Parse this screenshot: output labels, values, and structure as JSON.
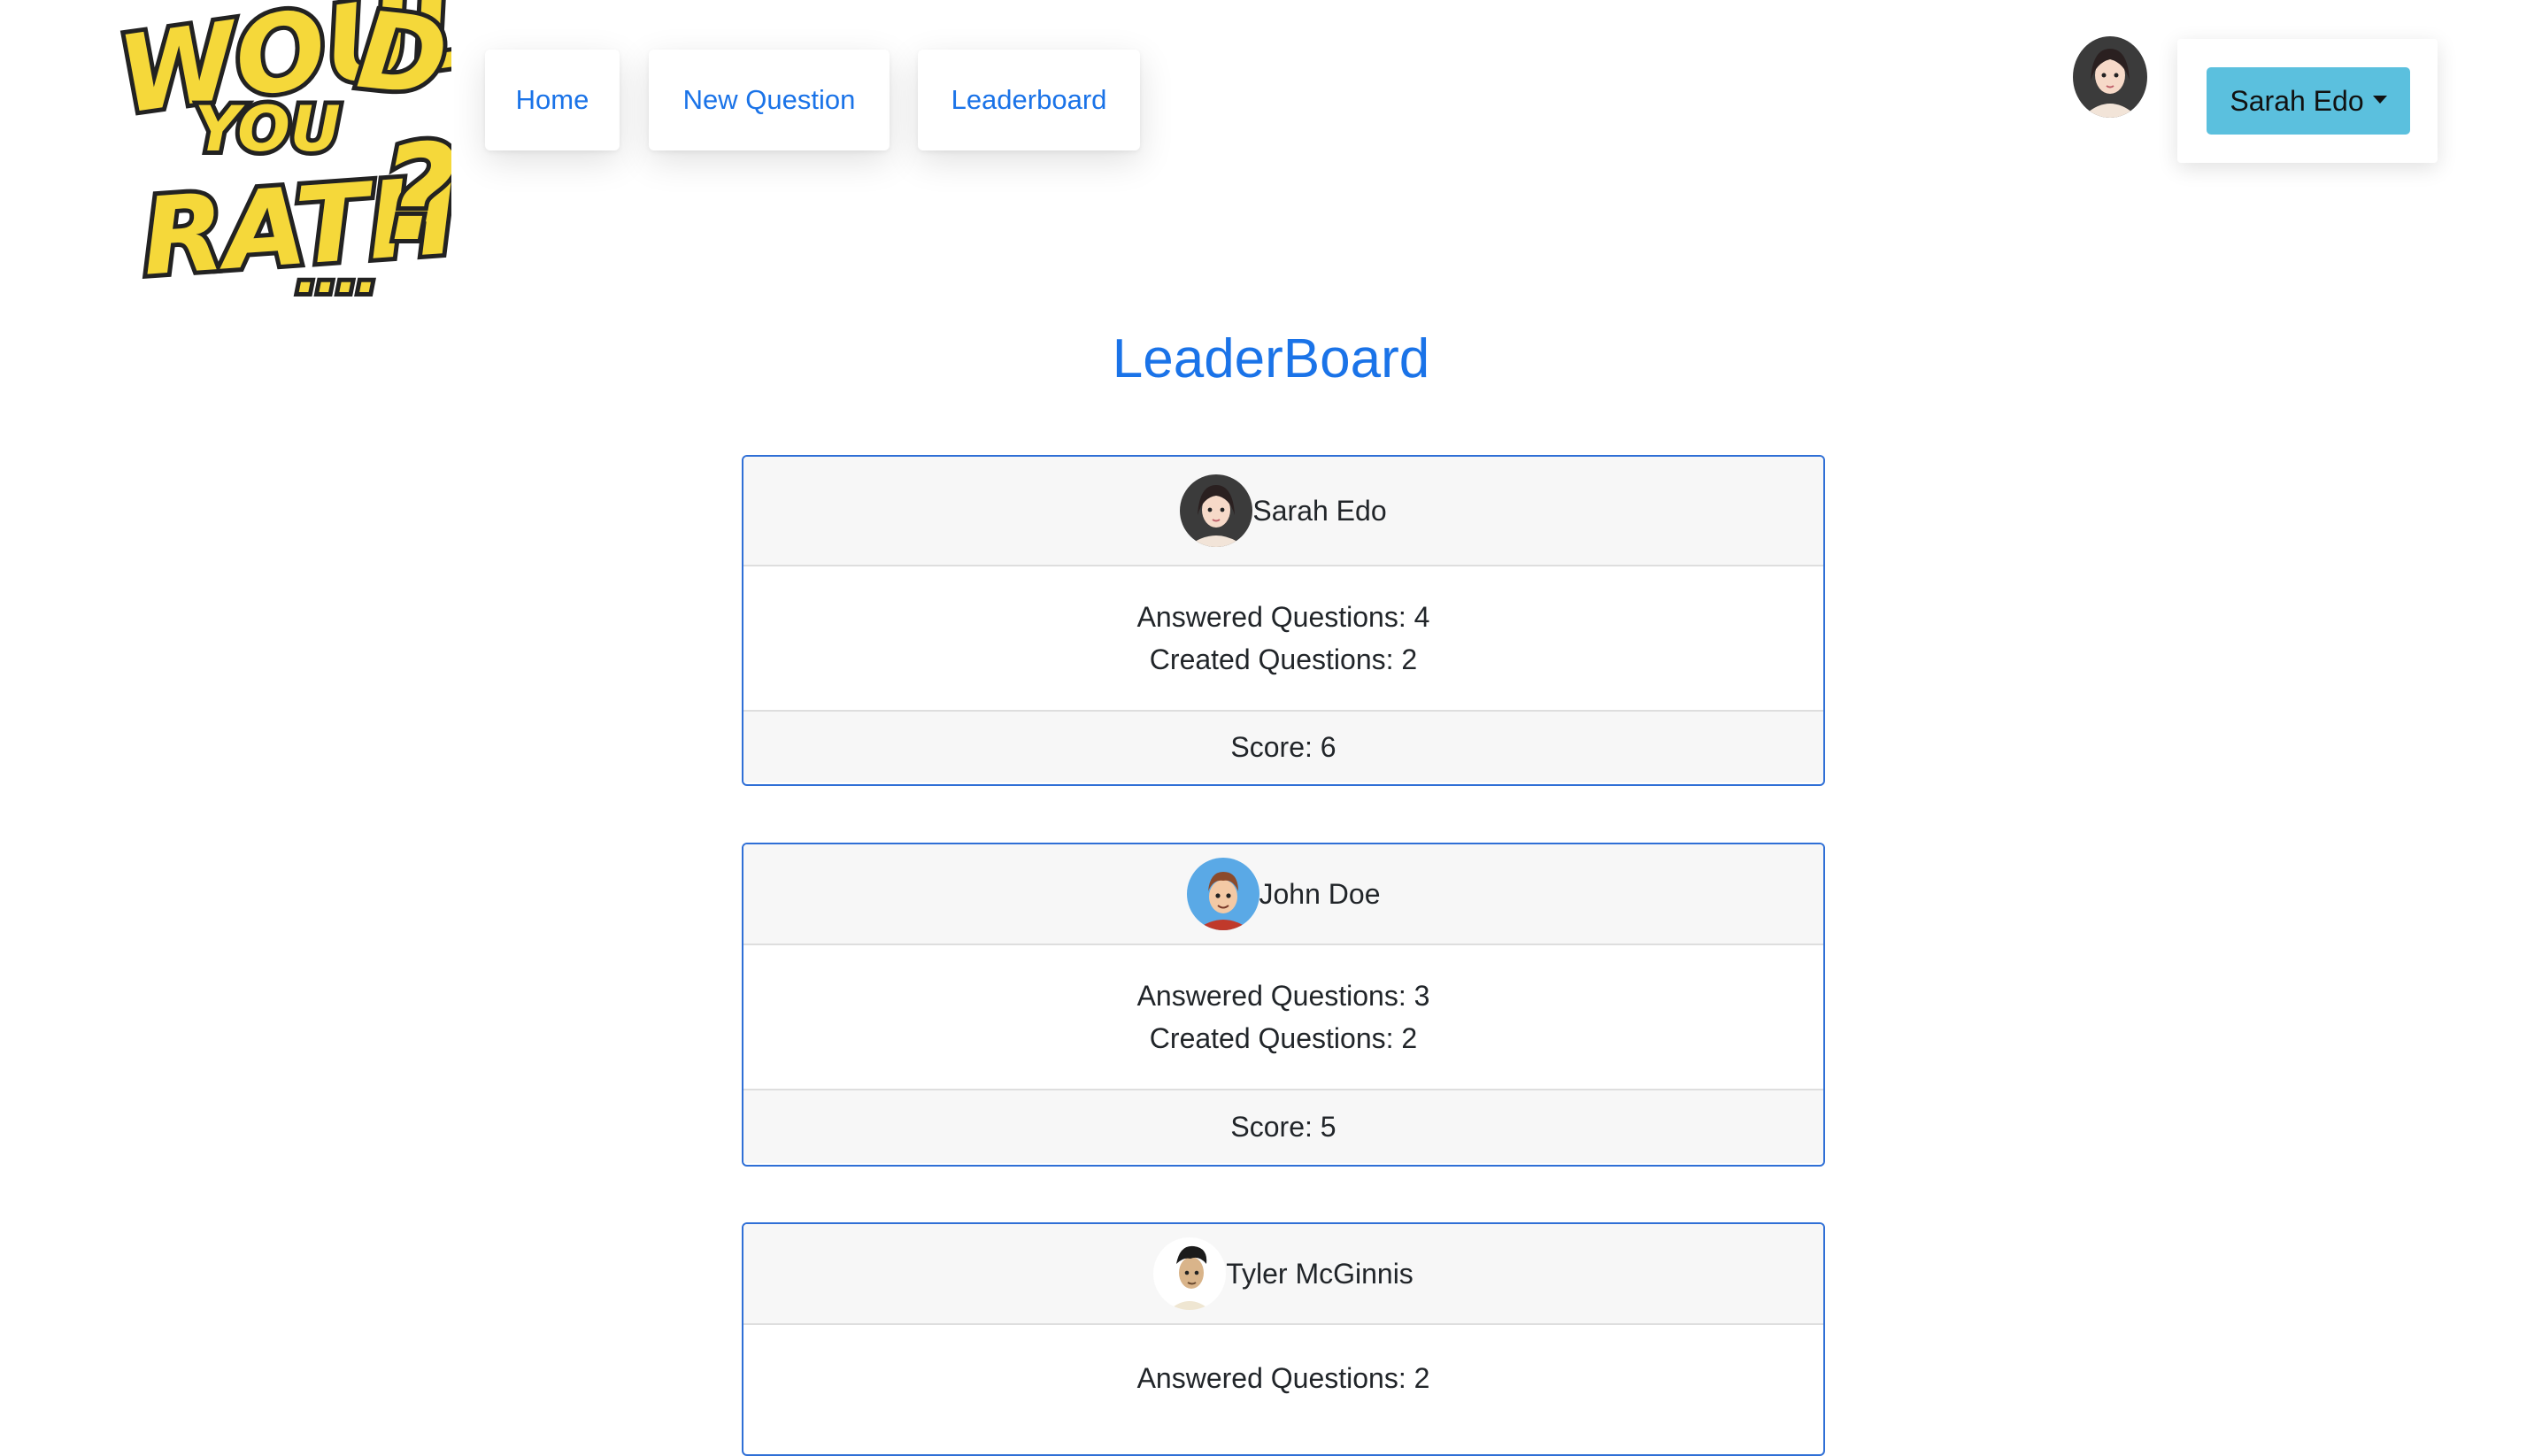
{
  "app": {
    "logo_text": "WOULD YOU RATHER?..."
  },
  "nav": {
    "home": "Home",
    "new_question": "New Question",
    "leaderboard": "Leaderboard"
  },
  "user": {
    "name": "Sarah Edo",
    "avatar_icon": "user-avatar-icon"
  },
  "page": {
    "title": "LeaderBoard"
  },
  "colors": {
    "accent": "#1a73e8",
    "dropdown_bg": "#5bc0de",
    "card_border": "#2f6fd6",
    "logo_yellow": "#f5d83a"
  },
  "leaderboard": [
    {
      "name": "Sarah Edo",
      "answered": "Answered Questions: 4",
      "created": "Created Questions: 2",
      "score": "Score: 6"
    },
    {
      "name": "John Doe",
      "answered": "Answered Questions: 3",
      "created": "Created Questions: 2",
      "score": "Score: 5"
    },
    {
      "name": "Tyler McGinnis",
      "answered": "Answered Questions: 2"
    }
  ]
}
